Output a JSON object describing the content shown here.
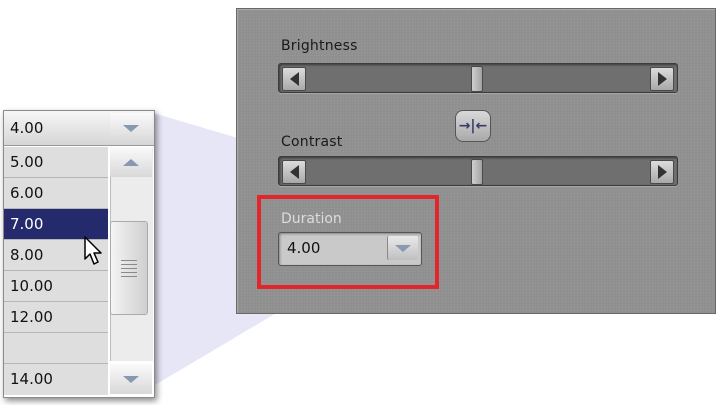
{
  "panel": {
    "brightness_label": "Brightness",
    "contrast_label": "Contrast",
    "duration_label": "Duration",
    "duration_value": "4.00"
  },
  "dropdown": {
    "current": "4.00",
    "options": [
      "5.00",
      "6.00",
      "7.00",
      "8.00",
      "10.00",
      "12.00",
      "14.00"
    ],
    "selected": "7.00"
  },
  "icons": {
    "slider_left": "arrow-left-icon",
    "slider_right": "arrow-right-icon",
    "link": "center-link-icon",
    "dropdown": "chevron-down-icon",
    "scroll_up": "chevron-up-icon"
  },
  "colors": {
    "highlight": "#e1262c",
    "selection": "#242a6c"
  }
}
